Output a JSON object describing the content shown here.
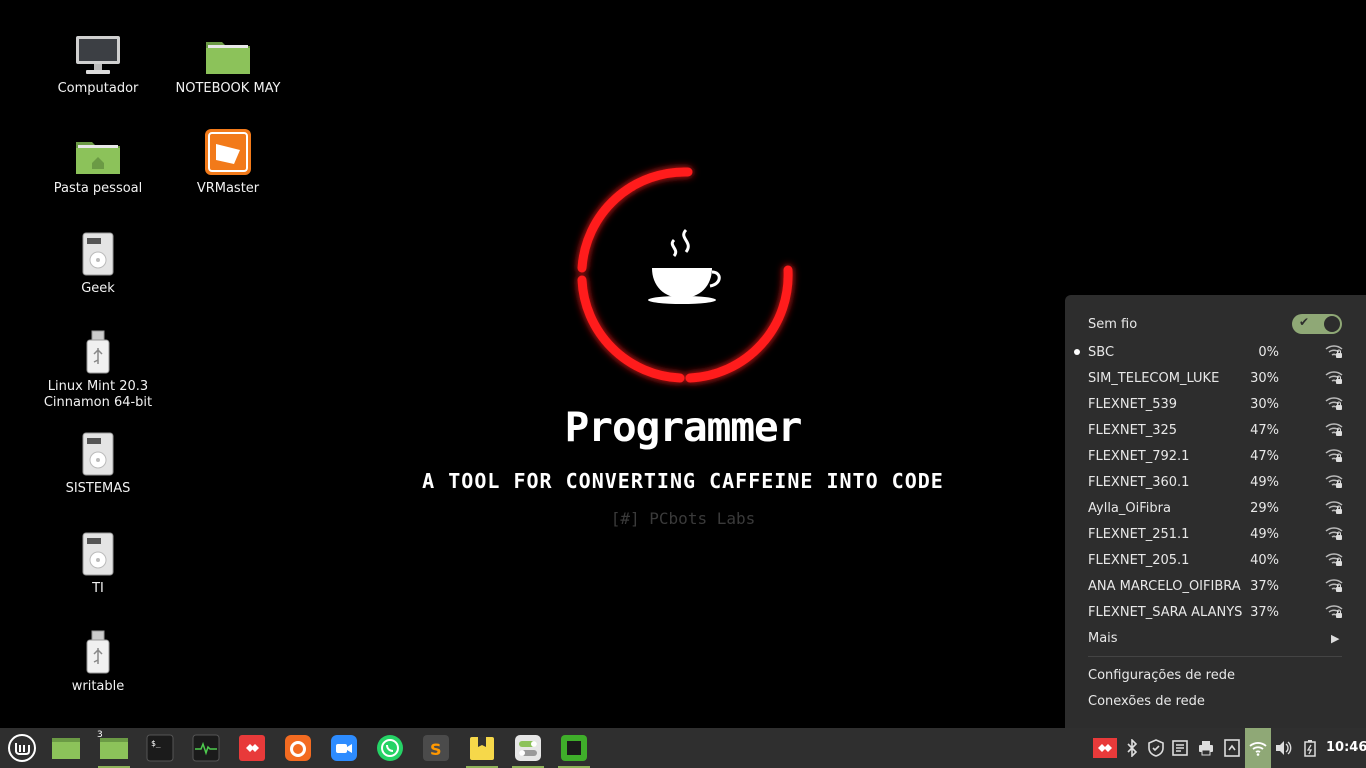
{
  "desktop": {
    "icons": [
      {
        "label": "Computador",
        "icon": "monitor-icon"
      },
      {
        "label": "NOTEBOOK MAY",
        "icon": "folder-icon"
      },
      {
        "label": "Pasta pessoal",
        "icon": "home-folder-icon"
      },
      {
        "label": "VRMaster",
        "icon": "vrmaster-app-icon"
      },
      {
        "label": "Geek",
        "icon": "drive-icon"
      },
      {
        "label": "Linux Mint 20.3\nCinnamon 64-bit",
        "icon": "usb-drive-icon"
      },
      {
        "label": "SISTEMAS",
        "icon": "drive-icon"
      },
      {
        "label": "TI",
        "icon": "drive-icon"
      },
      {
        "label": "writable",
        "icon": "usb-drive-icon"
      }
    ]
  },
  "wallpaper": {
    "title": "Programmer",
    "subtitle": "A TOOL FOR CONVERTING CAFFEINE INTO CODE",
    "brand": "[#] PCbots Labs",
    "ring_color": "#ff1a1a"
  },
  "network_menu": {
    "header": "Sem fio",
    "wifi_enabled": true,
    "networks": [
      {
        "ssid": "SBC",
        "strength": "0%",
        "connected": true
      },
      {
        "ssid": "SIM_TELECOM_LUKE",
        "strength": "30%"
      },
      {
        "ssid": "FLEXNET_539",
        "strength": "30%"
      },
      {
        "ssid": "FLEXNET_325",
        "strength": "47%"
      },
      {
        "ssid": "FLEXNET_792.1",
        "strength": "47%"
      },
      {
        "ssid": "FLEXNET_360.1",
        "strength": "49%"
      },
      {
        "ssid": "Aylla_OiFibra",
        "strength": "29%"
      },
      {
        "ssid": "FLEXNET_251.1",
        "strength": "49%"
      },
      {
        "ssid": "FLEXNET_205.1",
        "strength": "40%"
      },
      {
        "ssid": "ANA MARCELO_OIFIBRA",
        "strength": "37%"
      },
      {
        "ssid": "FLEXNET_SARA ALANYS",
        "strength": "37%"
      }
    ],
    "more": "Mais",
    "settings": "Configurações de rede",
    "connections": "Conexões de rede"
  },
  "taskbar": {
    "apps": [
      {
        "icon": "mint-menu-icon"
      },
      {
        "icon": "files-icon"
      },
      {
        "icon": "files-icon",
        "badge": "3",
        "active": true
      },
      {
        "icon": "terminal-icon"
      },
      {
        "icon": "system-monitor-icon"
      },
      {
        "icon": "anydesk-icon"
      },
      {
        "icon": "firefox-icon"
      },
      {
        "icon": "zoom-icon"
      },
      {
        "icon": "whatsapp-icon"
      },
      {
        "icon": "sublime-text-icon"
      },
      {
        "icon": "sticky-notes-icon",
        "active": true
      },
      {
        "icon": "settings-toggle-icon",
        "active": true
      },
      {
        "icon": "hardware-icon",
        "active": true
      }
    ],
    "tray": [
      "anydesk-tray-icon",
      "bluetooth-icon",
      "shield-icon",
      "notes-icon",
      "printer-icon",
      "update-icon",
      "wifi-icon",
      "volume-icon",
      "battery-icon"
    ],
    "clock": "10:46",
    "accent": "#8fa876"
  }
}
